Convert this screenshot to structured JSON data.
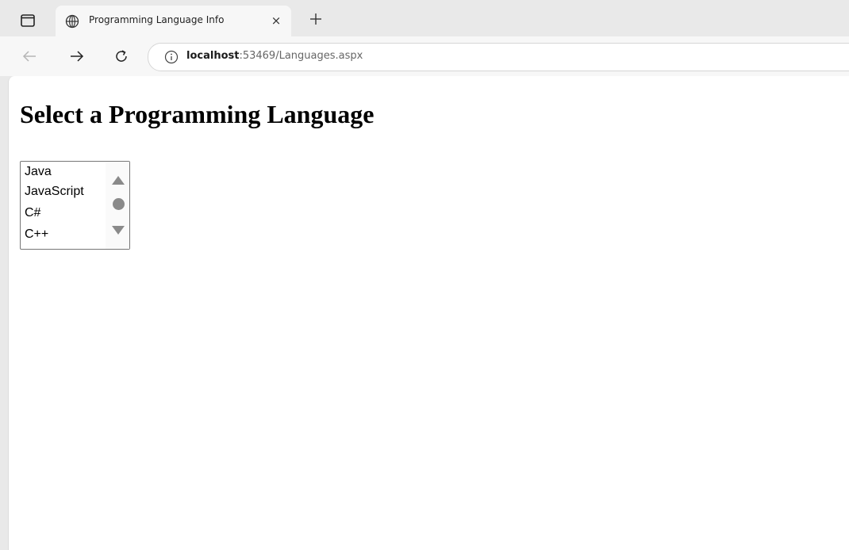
{
  "browser": {
    "tab": {
      "title": "Programming Language Info",
      "close_glyph": "×",
      "favicon": "globe-icon"
    },
    "new_tab_glyph": "+",
    "address_bar": {
      "host": "localhost",
      "path": ":53469/Languages.aspx",
      "security_icon": "info-icon"
    },
    "nav_icons": [
      "back-arrow-icon",
      "forward-arrow-icon",
      "reload-icon"
    ]
  },
  "page": {
    "heading": "Select a Programming Language",
    "language_list": {
      "options": [
        "Java",
        "JavaScript",
        "C#",
        "C++"
      ]
    }
  },
  "colors": {
    "chrome_background": "#e9e9e9",
    "toolbar_background": "#f7f7f7",
    "page_background": "#ffffff",
    "scrollbar_thumb": "#8a8a8a"
  }
}
